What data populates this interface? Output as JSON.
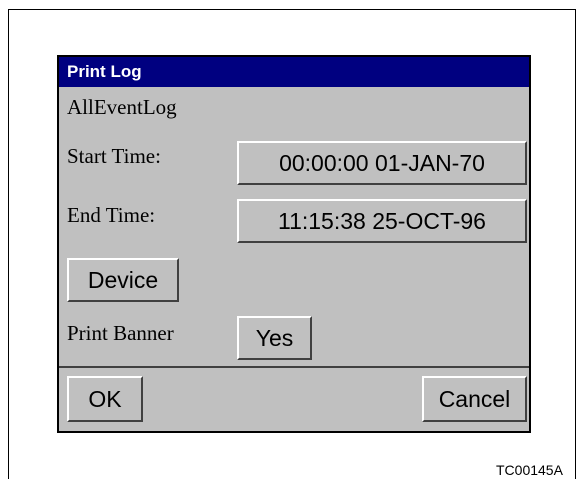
{
  "dialog": {
    "title": "Print Log",
    "log_name": "AllEventLog",
    "start_time_label": "Start Time:",
    "start_time_value": "00:00:00  01-JAN-70",
    "end_time_label": "End Time:",
    "end_time_value": "11:15:38  25-OCT-96",
    "device_button": "Device",
    "print_banner_label": "Print Banner",
    "print_banner_value": "Yes",
    "ok_button": "OK",
    "cancel_button": "Cancel"
  },
  "figure_id": "TC00145A"
}
